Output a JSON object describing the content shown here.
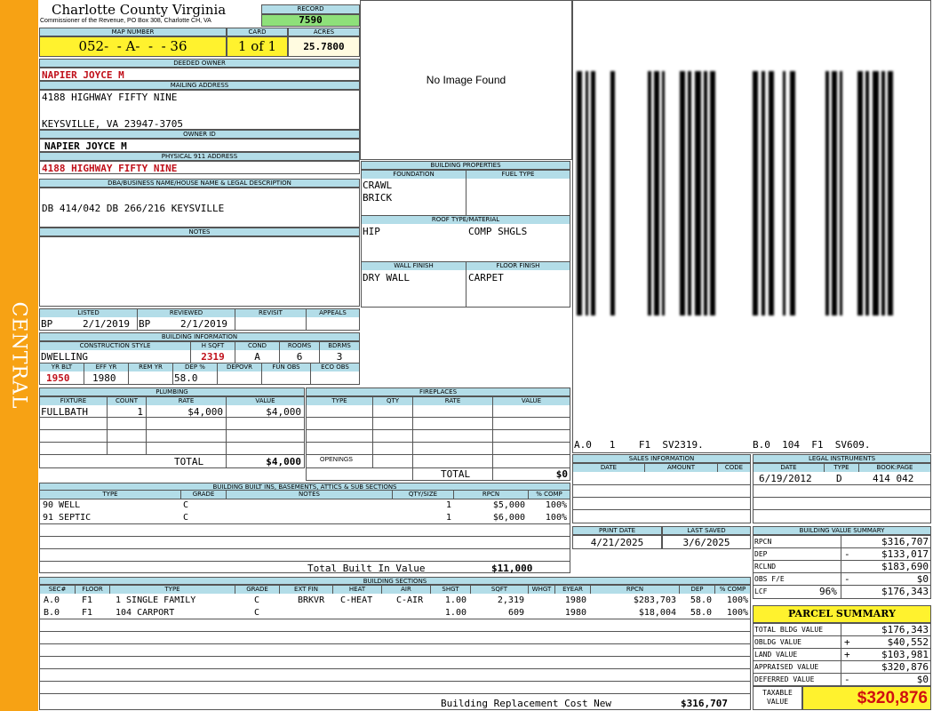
{
  "sidebar": {
    "label": "CENTRAL"
  },
  "county": {
    "title": "Charlotte County Virginia",
    "subtitle": "Commissioner of the Revenue, PO Box 308, Charlotte CH, VA"
  },
  "record": {
    "label": "RECORD",
    "value": "7590"
  },
  "map": {
    "map_label": "MAP NUMBER",
    "map_value": "052-  - A-  -  - 36",
    "card_label": "CARD",
    "card_value": "1 of 1",
    "acres_label": "ACRES",
    "acres_value": "25.7800"
  },
  "owner": {
    "deeded_label": "DEEDED OWNER",
    "deeded_value": "NAPIER JOYCE M",
    "mailing_label": "MAILING ADDRESS",
    "mail_line1": "4188 HIGHWAY FIFTY NINE",
    "mail_line2": "KEYSVILLE, VA 23947-3705",
    "owner_id_label": "OWNER ID",
    "owner_id_value": "NAPIER JOYCE M",
    "physical_label": "PHYSICAL 911 ADDRESS",
    "physical_value": "4188 HIGHWAY FIFTY NINE",
    "dba_label": "DBA/BUSINESS NAME/HOUSE NAME & LEGAL DESCRIPTION",
    "dba_value": "DB 414/042 DB 266/216 KEYSVILLE",
    "notes_label": "NOTES"
  },
  "image": {
    "placeholder": "No Image Found"
  },
  "building_props": {
    "title": "BUILDING PROPERTIES",
    "foundation_label": "FOUNDATION",
    "fuel_label": "FUEL TYPE",
    "foundation1": "CRAWL",
    "foundation2": "BRICK",
    "roof_label": "ROOF TYPE/MATERIAL",
    "roof1": "HIP",
    "roof2": "COMP SHGLS",
    "wall_label": "WALL FINISH",
    "floor_label": "FLOOR FINISH",
    "wall_value": "DRY WALL",
    "floor_value": "CARPET"
  },
  "sketch": {
    "label1": "A.0   1    F1  SV2319.",
    "label2": "B.0  104  F1  SV609."
  },
  "listing": {
    "listed_label": "LISTED",
    "reviewed_label": "REVIEWED",
    "revisit_label": "REVISIT",
    "appeals_label": "APPEALS",
    "listed_by": "BP",
    "listed_date": "2/1/2019",
    "reviewed_by": "BP",
    "reviewed_date": "2/1/2019"
  },
  "building_info": {
    "title": "BUILDING INFORMATION",
    "style_label": "CONSTRUCTION STYLE",
    "hsqft_label": "H SQFT",
    "cond_label": "COND",
    "rooms_label": "ROOMS",
    "bdrms_label": "BDRMS",
    "style_value": "DWELLING",
    "hsqft_value": "2319",
    "cond_value": "A",
    "rooms_value": "6",
    "bdrms_value": "3",
    "yrblt_label": "YR BLT",
    "effyr_label": "EFF YR",
    "remyr_label": "REM YR",
    "dep_label": "DEP %",
    "depovr_label": "DEPOVR",
    "funobs_label": "FUN OBS",
    "ecoobs_label": "ECO OBS",
    "yrblt_value": "1950",
    "effyr_value": "1980",
    "dep_value": "58.0"
  },
  "plumbing": {
    "title": "PLUMBING",
    "headers": [
      "FIXTURE",
      "COUNT",
      "RATE",
      "VALUE"
    ],
    "rows": [
      {
        "fixture": "FULLBATH",
        "count": "1",
        "rate": "$4,000",
        "value": "$4,000"
      }
    ],
    "total_label": "TOTAL",
    "total_value": "$4,000"
  },
  "fireplaces": {
    "title": "FIREPLACES",
    "headers": [
      "TYPE",
      "QTY",
      "RATE",
      "VALUE"
    ],
    "openings_label": "OPENINGS",
    "total_label": "TOTAL",
    "total_value": "$0"
  },
  "builtins": {
    "title": "BUILDING BUILT INS, BASEMENTS, ATTICS & SUB SECTIONS",
    "headers": [
      "TYPE",
      "GRADE",
      "NOTES",
      "QTY/SIZE",
      "RPCN",
      "% COMP"
    ],
    "rows": [
      {
        "type": "90 WELL",
        "grade": "C",
        "qty": "1",
        "rpcn": "$5,000",
        "comp": "100%"
      },
      {
        "type": "91 SEPTIC",
        "grade": "C",
        "qty": "1",
        "rpcn": "$6,000",
        "comp": "100%"
      }
    ],
    "total_label": "Total Built In Value",
    "total_value": "$11,000"
  },
  "sales": {
    "title": "SALES INFORMATION",
    "headers": [
      "DATE",
      "AMOUNT",
      "CODE"
    ]
  },
  "legal": {
    "title": "LEGAL INSTRUMENTS",
    "headers": [
      "DATE",
      "TYPE",
      "BOOK:PAGE"
    ],
    "rows": [
      {
        "date": "6/19/2012",
        "type": "D",
        "bookpage": "414 042"
      }
    ]
  },
  "dates": {
    "print_label": "PRINT DATE",
    "saved_label": "LAST SAVED",
    "print_value": "4/21/2025",
    "saved_value": "3/6/2025"
  },
  "bvs": {
    "title": "BUILDING VALUE SUMMARY",
    "rows": [
      {
        "label": "RPCN",
        "sign": "",
        "value": "$316,707"
      },
      {
        "label": "DEP",
        "sign": "-",
        "value": "$133,017"
      },
      {
        "label": "RCLND",
        "sign": "",
        "value": "$183,690"
      },
      {
        "label": "OBS F/E",
        "sign": "-",
        "value": "$0"
      },
      {
        "label": "LCF",
        "pct": "96%",
        "sign": "",
        "value": "$176,343"
      }
    ]
  },
  "parcel": {
    "title": "PARCEL SUMMARY",
    "rows": [
      {
        "label": "TOTAL BLDG VALUE",
        "sign": "",
        "value": "$176,343"
      },
      {
        "label": "OBLDG VALUE",
        "sign": "+",
        "value": "$40,552"
      },
      {
        "label": "LAND VALUE",
        "sign": "+",
        "value": "$103,981"
      },
      {
        "label": "APPRAISED VALUE",
        "sign": "",
        "value": "$320,876"
      },
      {
        "label": "DEFERRED VALUE",
        "sign": "-",
        "value": "$0"
      }
    ],
    "taxable_label1": "TAXABLE",
    "taxable_label2": "VALUE",
    "taxable_value": "$320,876"
  },
  "sections": {
    "title": "BUILDING SECTIONS",
    "headers": [
      "SEC#",
      "FLOOR",
      "TYPE",
      "GRADE",
      "EXT FIN",
      "HEAT",
      "AIR",
      "SHGT",
      "SQFT",
      "WHGT",
      "EYEAR",
      "RPCN",
      "DEP",
      "% COMP"
    ],
    "rows": [
      {
        "sec": "A.0",
        "floor": "F1",
        "type": "1 SINGLE FAMILY",
        "grade": "C",
        "extfin": "BRKVR",
        "heat": "C-HEAT",
        "air": "C-AIR",
        "shgt": "1.00",
        "sqft": "2,319",
        "eyear": "1980",
        "rpcn": "$283,703",
        "dep": "58.0",
        "comp": "100%"
      },
      {
        "sec": "B.0",
        "floor": "F1",
        "type": "104 CARPORT",
        "grade": "C",
        "extfin": "",
        "heat": "",
        "air": "",
        "shgt": "1.00",
        "sqft": "609",
        "eyear": "1980",
        "rpcn": "$18,004",
        "dep": "58.0",
        "comp": "100%"
      }
    ],
    "total_label": "Building Replacement Cost New",
    "total_value": "$316,707"
  }
}
